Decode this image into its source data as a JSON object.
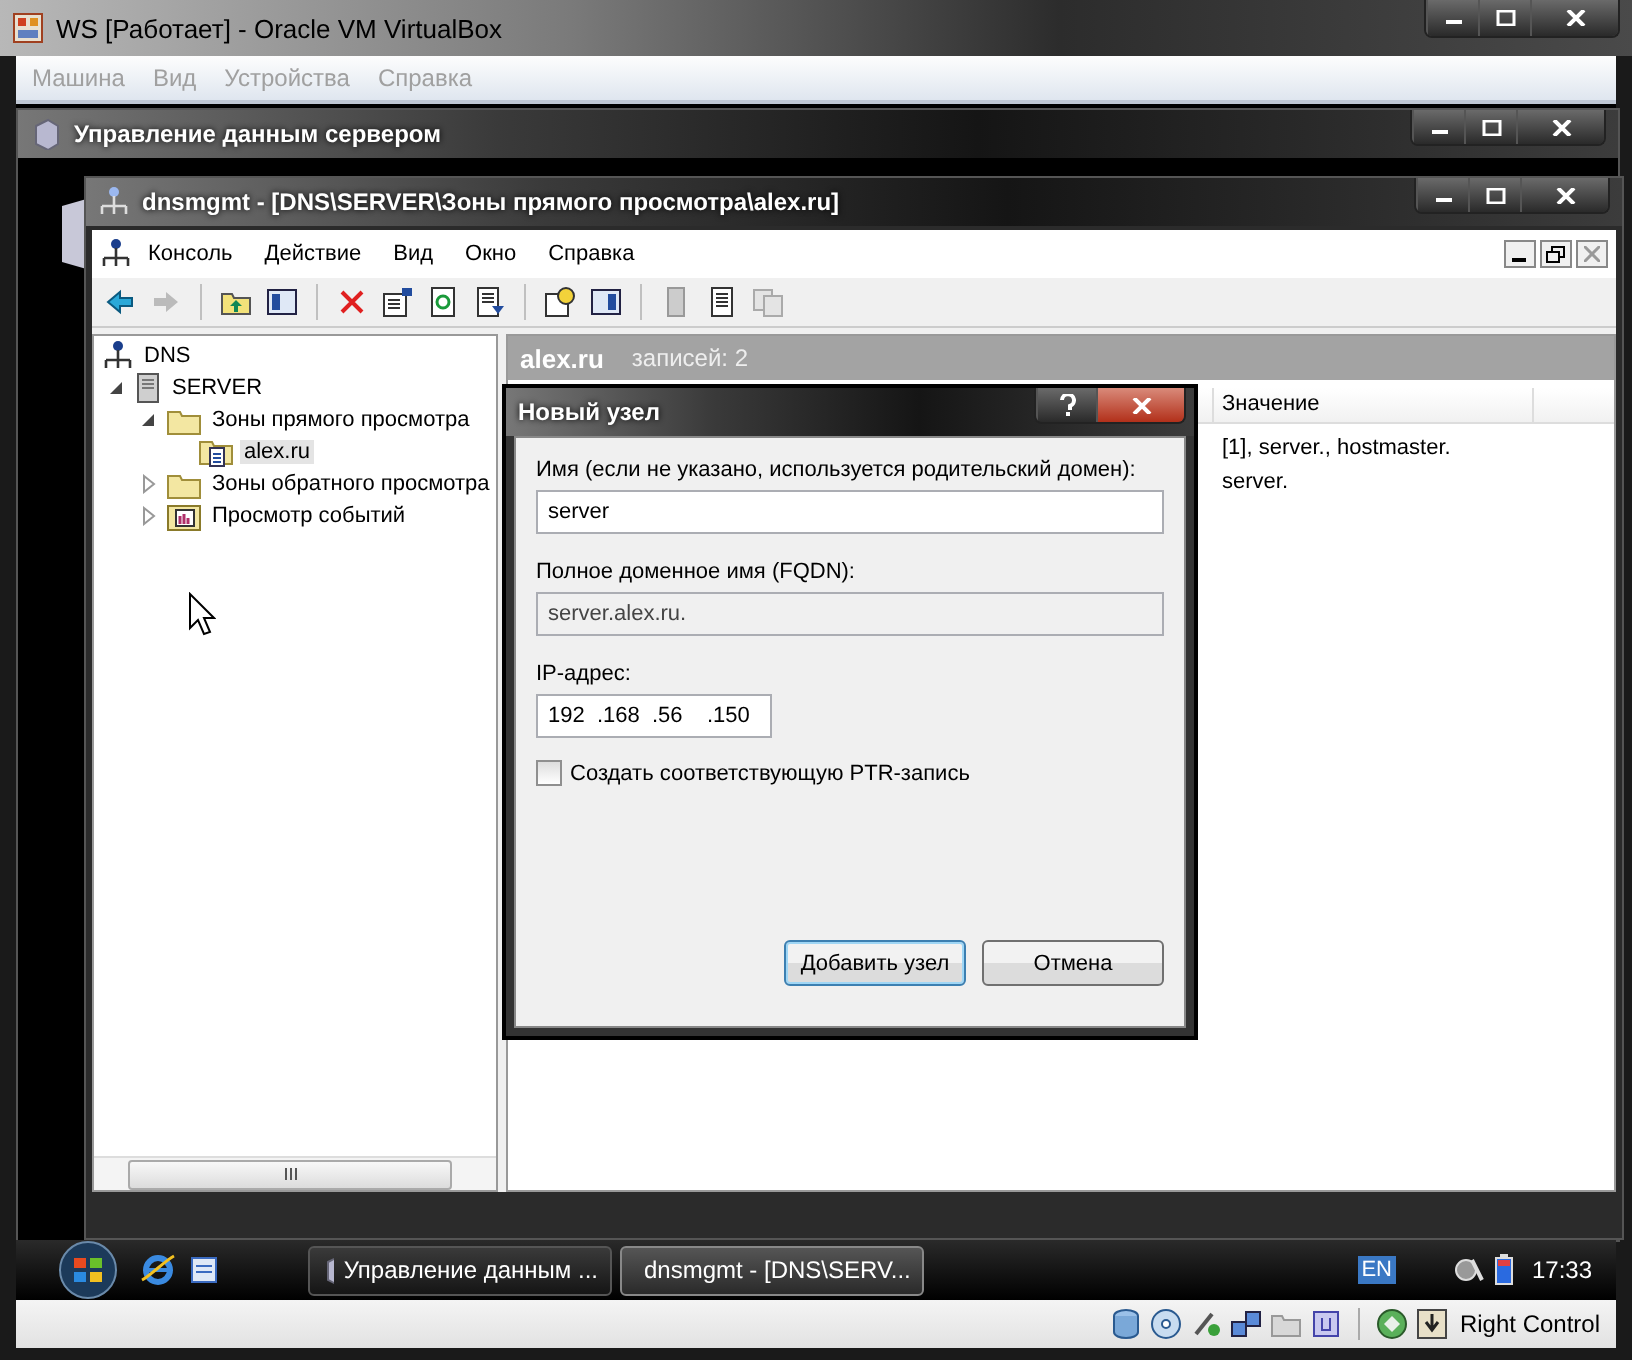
{
  "window": {
    "title": "WS [Работает] - Oracle VM VirtualBox"
  },
  "menu": [
    {
      "label": "Машина",
      "disabled": true
    },
    {
      "label": "Вид",
      "disabled": true
    },
    {
      "label": "Устройства",
      "disabled": true
    },
    {
      "label": "Справка",
      "disabled": true
    }
  ],
  "server_manager": {
    "title": "Управление данным сервером"
  },
  "mmc": {
    "title": "dnsmgmt - [DNS\\SERVER\\Зоны прямого просмотра\\alex.ru]",
    "menu": [
      "Консоль",
      "Действие",
      "Вид",
      "Окно",
      "Справка"
    ],
    "tree": [
      {
        "label": "DNS",
        "kind": "dns",
        "selected": false,
        "children": [
          {
            "label": "SERVER",
            "kind": "server",
            "expanded": true,
            "selected": false,
            "children": [
              {
                "label": "Зоны прямого просмотра",
                "kind": "folder",
                "expanded": true,
                "selected": false,
                "children": [
                  {
                    "label": "alex.ru",
                    "kind": "zone",
                    "selected": true
                  }
                ]
              },
              {
                "label": "Зоны обратного просмотра",
                "kind": "folder",
                "expanded": false,
                "selected": false
              },
              {
                "label": "Просмотр событий",
                "kind": "events",
                "expanded": false,
                "selected": false
              }
            ]
          }
        ]
      }
    ],
    "details": {
      "title": "alex.ru",
      "count": "записей: 2",
      "columns": [
        "Значение"
      ],
      "rows": [
        [
          "[1], server., hostmaster."
        ],
        [
          "server."
        ]
      ]
    }
  },
  "dialog": {
    "title": "Новый узел",
    "fields": [
      {
        "label": "Имя (если не указано, используется родительский домен):",
        "value": "server",
        "kind": "text",
        "disabled": false
      },
      {
        "label": "Полное доменное имя (FQDN):",
        "value": "server.alex.ru.",
        "kind": "text",
        "disabled": true
      },
      {
        "label": "IP-адрес:",
        "value": "192  .168  .56    .150",
        "kind": "ip",
        "disabled": false
      }
    ],
    "checkbox": {
      "label": "Создать соответствующую PTR-запись",
      "checked": false
    },
    "buttons": [
      {
        "label": "Добавить узел",
        "default": true
      },
      {
        "label": "Отмена",
        "default": false
      }
    ]
  },
  "taskbar": {
    "tasks": [
      {
        "label": "Управление данным ...",
        "selected": false
      },
      {
        "label": "dnsmgmt - [DNS\\SERV...",
        "selected": true
      }
    ],
    "language": "EN",
    "clock": "17:33"
  },
  "status_bar": {
    "host_key": "Right Control"
  }
}
